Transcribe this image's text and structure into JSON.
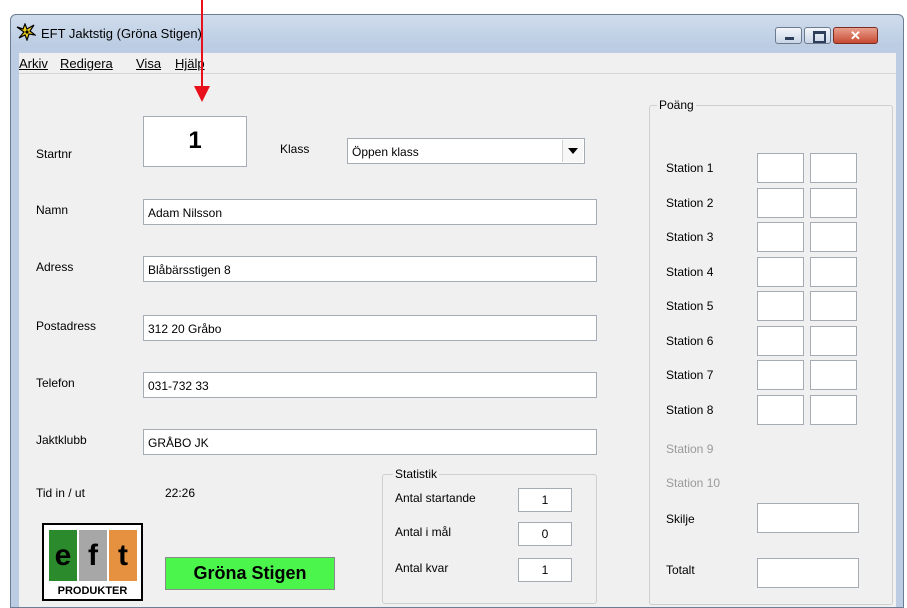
{
  "window": {
    "title": "EFT Jaktstig (Gröna Stigen)"
  },
  "menu": [
    "Arkiv",
    "Redigera",
    "Visa",
    "Hjälp"
  ],
  "form": {
    "startnr_label": "Startnr",
    "startnr_value": "1",
    "klass_label": "Klass",
    "klass_value": "Öppen klass",
    "namn_label": "Namn",
    "namn_value": "Adam Nilsson",
    "adress_label": "Adress",
    "adress_value": "Blåbärsstigen 8",
    "postadress_label": "Postadress",
    "postadress_value": "312 20 Gråbo",
    "telefon_label": "Telefon",
    "telefon_value": "031-732 33",
    "jaktklubb_label": "Jaktklubb",
    "jaktklubb_value": "GRÅBO JK",
    "tid_label": "Tid in / ut",
    "tid_value": "22:26"
  },
  "statistik": {
    "title": "Statistik",
    "rows": [
      {
        "label": "Antal startande",
        "value": "1"
      },
      {
        "label": "Antal i mål",
        "value": "0"
      },
      {
        "label": "Antal kvar",
        "value": "1"
      }
    ]
  },
  "poang": {
    "title": "Poäng",
    "stations": [
      "Station 1",
      "Station 2",
      "Station 3",
      "Station 4",
      "Station 5",
      "Station 6",
      "Station 7",
      "Station 8"
    ],
    "disabled_stations": [
      "Station 9",
      "Station 10"
    ],
    "skilje_label": "Skilje",
    "totalt_label": "Totalt"
  },
  "logo": {
    "letters": [
      "e",
      "f",
      "t"
    ],
    "text": "PRODUKTER"
  },
  "banner": {
    "text": "Gröna Stigen",
    "color": "#4cf54c"
  },
  "colors": {
    "arrow": "#e8101a",
    "logo_green": "#2b8a2b",
    "logo_gray": "#a7a7a7",
    "logo_orange": "#e69140"
  }
}
